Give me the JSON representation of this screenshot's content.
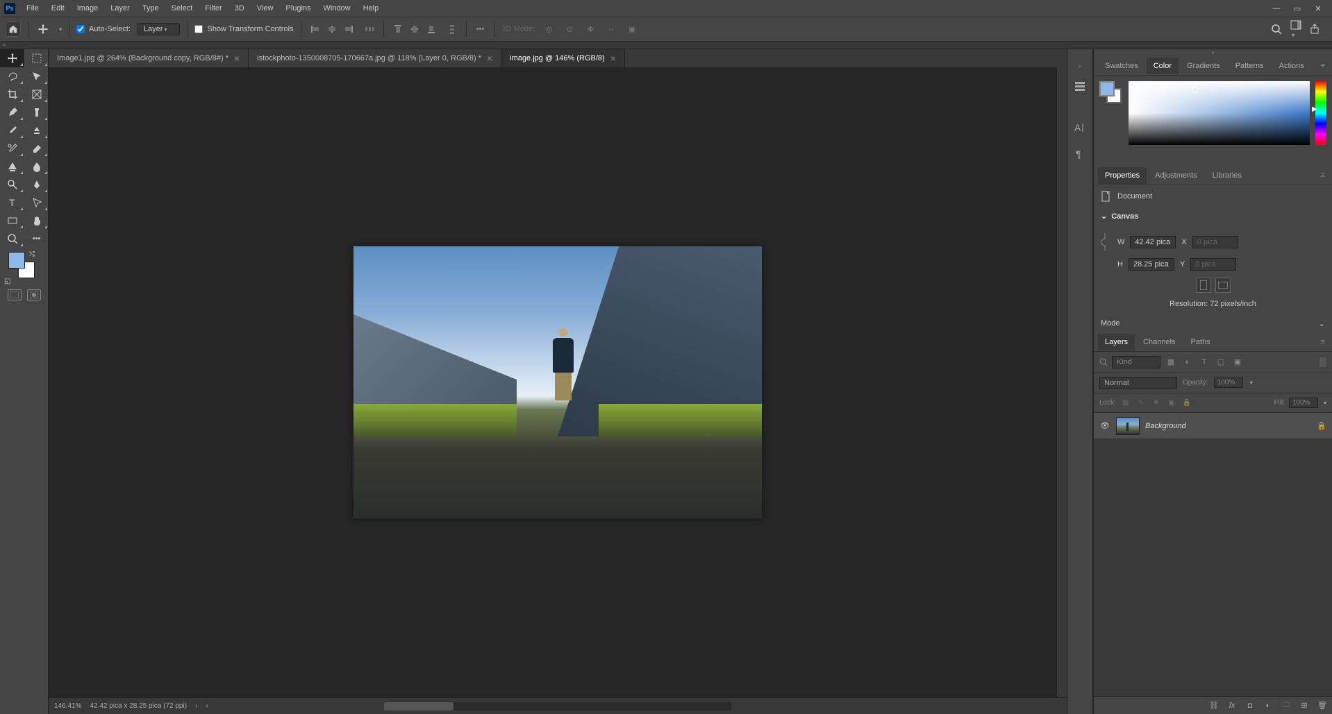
{
  "menu": [
    "File",
    "Edit",
    "Image",
    "Layer",
    "Type",
    "Select",
    "Filter",
    "3D",
    "View",
    "Plugins",
    "Window",
    "Help"
  ],
  "options": {
    "auto_select_label": "Auto-Select:",
    "auto_select_target": "Layer",
    "show_transform": "Show Transform Controls",
    "three_d_mode": "3D Mode:"
  },
  "tabs": [
    {
      "label": "Image1.jpg @ 264% (Background copy, RGB/8#) *",
      "active": false
    },
    {
      "label": "istockphoto-1350008705-170667a.jpg @ 118% (Layer 0, RGB/8) *",
      "active": false
    },
    {
      "label": "image.jpg @ 146% (RGB/8)",
      "active": true
    }
  ],
  "status": {
    "zoom": "146.41%",
    "dims": "42.42 pica x 28.25 pica (72 ppi)"
  },
  "color_panel": {
    "tabs": [
      "Swatches",
      "Color",
      "Gradients",
      "Patterns",
      "Actions"
    ],
    "active": "Color",
    "fg": "#8fb8e8",
    "bg": "#ffffff"
  },
  "props_panel": {
    "tabs": [
      "Properties",
      "Adjustments",
      "Libraries"
    ],
    "active": "Properties",
    "type_label": "Document",
    "section": "Canvas",
    "w_label": "W",
    "w_val": "42.42 pica",
    "h_label": "H",
    "h_val": "28.25 pica",
    "x_label": "X",
    "x_val": "0 pica",
    "y_label": "Y",
    "y_val": "0 pica",
    "resolution": "Resolution: 72 pixels/inch",
    "mode_label": "Mode"
  },
  "layers_panel": {
    "tabs": [
      "Layers",
      "Channels",
      "Paths"
    ],
    "active": "Layers",
    "kind_placeholder": "Kind",
    "blend_mode": "Normal",
    "opacity_label": "Opacity:",
    "opacity_val": "100%",
    "lock_label": "Lock:",
    "fill_label": "Fill:",
    "fill_val": "100%",
    "layer_name": "Background"
  }
}
